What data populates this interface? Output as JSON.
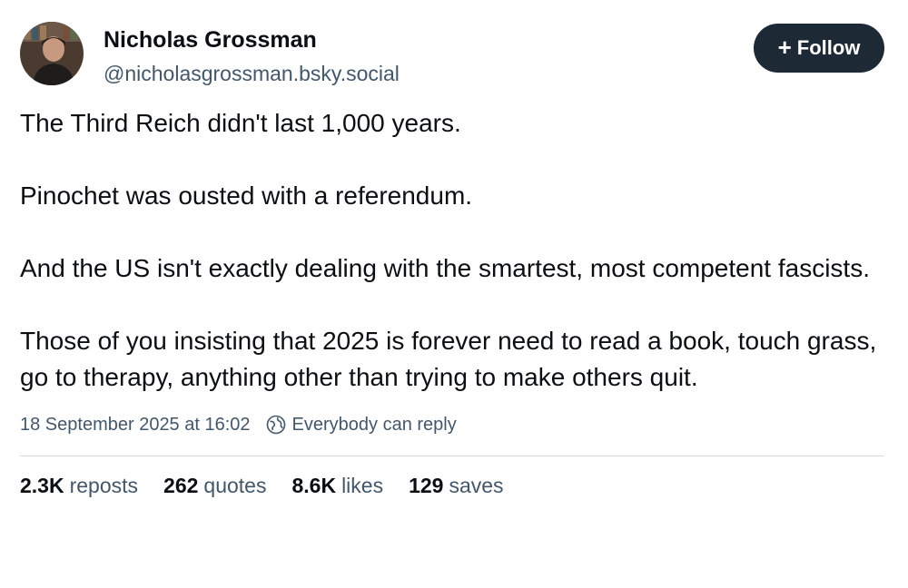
{
  "post": {
    "author": {
      "name": "Nicholas Grossman",
      "handle": "@nicholasgrossman.bsky.social"
    },
    "follow_button": {
      "icon": "plus-icon",
      "label": "Follow"
    },
    "paragraphs": [
      "The Third Reich didn't last 1,000 years.",
      "Pinochet was ousted with a referendum.",
      "And the US isn't exactly dealing with the smartest, most competent fascists.",
      "Those of you insisting that 2025 is forever need to read a book, touch grass, go to therapy, anything other than trying to make others quit."
    ],
    "timestamp": "18 September 2025 at 16:02",
    "reply_setting": {
      "icon": "globe-icon",
      "label": "Everybody can reply"
    },
    "stats": [
      {
        "count": "2.3K",
        "label": "reposts"
      },
      {
        "count": "262",
        "label": "quotes"
      },
      {
        "count": "8.6K",
        "label": "likes"
      },
      {
        "count": "129",
        "label": "saves"
      }
    ]
  },
  "colors": {
    "text": "#0b0f14",
    "secondary_text": "#42576c",
    "follow_button_bg": "#1e2936",
    "divider": "#d4dbe2"
  }
}
